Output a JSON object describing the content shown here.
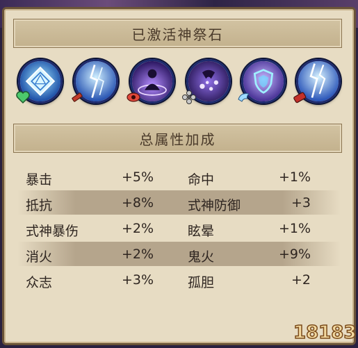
{
  "headers": {
    "activated": "已激活神祭石",
    "total_bonus": "总属性加成"
  },
  "stone_icons": [
    {
      "icon": "diamond-rune-icon",
      "badge": "heart-badge-icon"
    },
    {
      "icon": "lightning-sword-icon",
      "badge": "sword-badge-icon"
    },
    {
      "icon": "summoning-circle-icon",
      "badge": "eye-badge-icon"
    },
    {
      "icon": "dark-scatter-icon",
      "badge": "flower-badge-icon"
    },
    {
      "icon": "shield-barrier-icon",
      "badge": "wing-badge-icon"
    },
    {
      "icon": "lightning-strike-icon",
      "badge": "drum-badge-icon"
    }
  ],
  "stats": [
    {
      "left_label": "暴击",
      "left_value": "+5%",
      "right_label": "命中",
      "right_value": "+1%"
    },
    {
      "left_label": "抵抗",
      "left_value": "+8%",
      "right_label": "式神防御",
      "right_value": "+3"
    },
    {
      "left_label": "式神暴伤",
      "left_value": "+2%",
      "right_label": "眩晕",
      "right_value": "+1%"
    },
    {
      "left_label": "消火",
      "left_value": "+2%",
      "right_label": "鬼火",
      "right_value": "+9%"
    },
    {
      "left_label": "众志",
      "left_value": "+3%",
      "right_label": "孤胆",
      "right_value": "+2"
    }
  ],
  "watermark": {
    "text": "18183"
  }
}
